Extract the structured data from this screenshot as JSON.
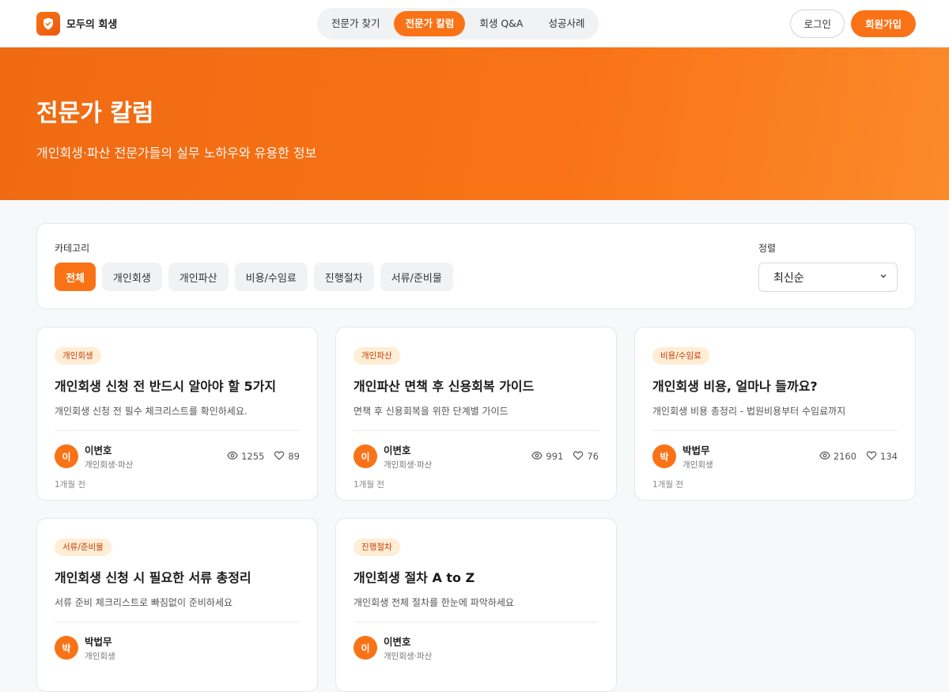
{
  "brand": {
    "name": "모두의 회생",
    "accent": "#f97316"
  },
  "nav": [
    {
      "label": "전문가 찾기",
      "active": false
    },
    {
      "label": "전문가 칼럼",
      "active": true
    },
    {
      "label": "회생 Q&A",
      "active": false
    },
    {
      "label": "성공사례",
      "active": false
    }
  ],
  "header": {
    "login_label": "로그인",
    "signup_label": "회원가입"
  },
  "hero": {
    "title": "전문가 칼럼",
    "subtitle": "개인회생·파산 전문가들의 실무 노하우와 유용한 정보"
  },
  "filter": {
    "category_label": "카테고리",
    "categories": [
      {
        "label": "전체",
        "active": true
      },
      {
        "label": "개인회생",
        "active": false
      },
      {
        "label": "개인파산",
        "active": false
      },
      {
        "label": "비용/수임료",
        "active": false
      },
      {
        "label": "진행절차",
        "active": false
      },
      {
        "label": "서류/준비물",
        "active": false
      }
    ],
    "sort_label": "정렬",
    "sort_value": "최신순"
  },
  "cards": [
    {
      "tag": "개인회생",
      "title": "개인회생 신청 전 반드시 알아야 할 5가지",
      "desc": "개인회생 신청 전 필수 체크리스트를 확인하세요.",
      "avatar": "이",
      "author": "이변호",
      "field": "개인회생·파산",
      "views": "1255",
      "likes": "89",
      "time": "1개월 전"
    },
    {
      "tag": "개인파산",
      "title": "개인파산 면책 후 신용회복 가이드",
      "desc": "면책 후 신용회복을 위한 단계별 가이드",
      "avatar": "이",
      "author": "이변호",
      "field": "개인회생·파산",
      "views": "991",
      "likes": "76",
      "time": "1개월 전"
    },
    {
      "tag": "비용/수임료",
      "title": "개인회생 비용, 얼마나 들까요?",
      "desc": "개인회생 비용 총정리 - 법원비용부터 수임료까지",
      "avatar": "박",
      "author": "박법무",
      "field": "개인회생",
      "views": "2160",
      "likes": "134",
      "time": "1개월 전"
    },
    {
      "tag": "서류/준비물",
      "title": "개인회생 신청 시 필요한 서류 총정리",
      "desc": "서류 준비 체크리스트로 빠짐없이 준비하세요",
      "avatar": "박",
      "author": "박법무",
      "field": "개인회생",
      "views": "",
      "likes": "",
      "time": ""
    },
    {
      "tag": "진행절차",
      "title": "개인회생 절차 A to Z",
      "desc": "개인회생 전체 절차를 한눈에 파악하세요",
      "avatar": "이",
      "author": "이변호",
      "field": "개인회생·파산",
      "views": "",
      "likes": "",
      "time": ""
    }
  ]
}
